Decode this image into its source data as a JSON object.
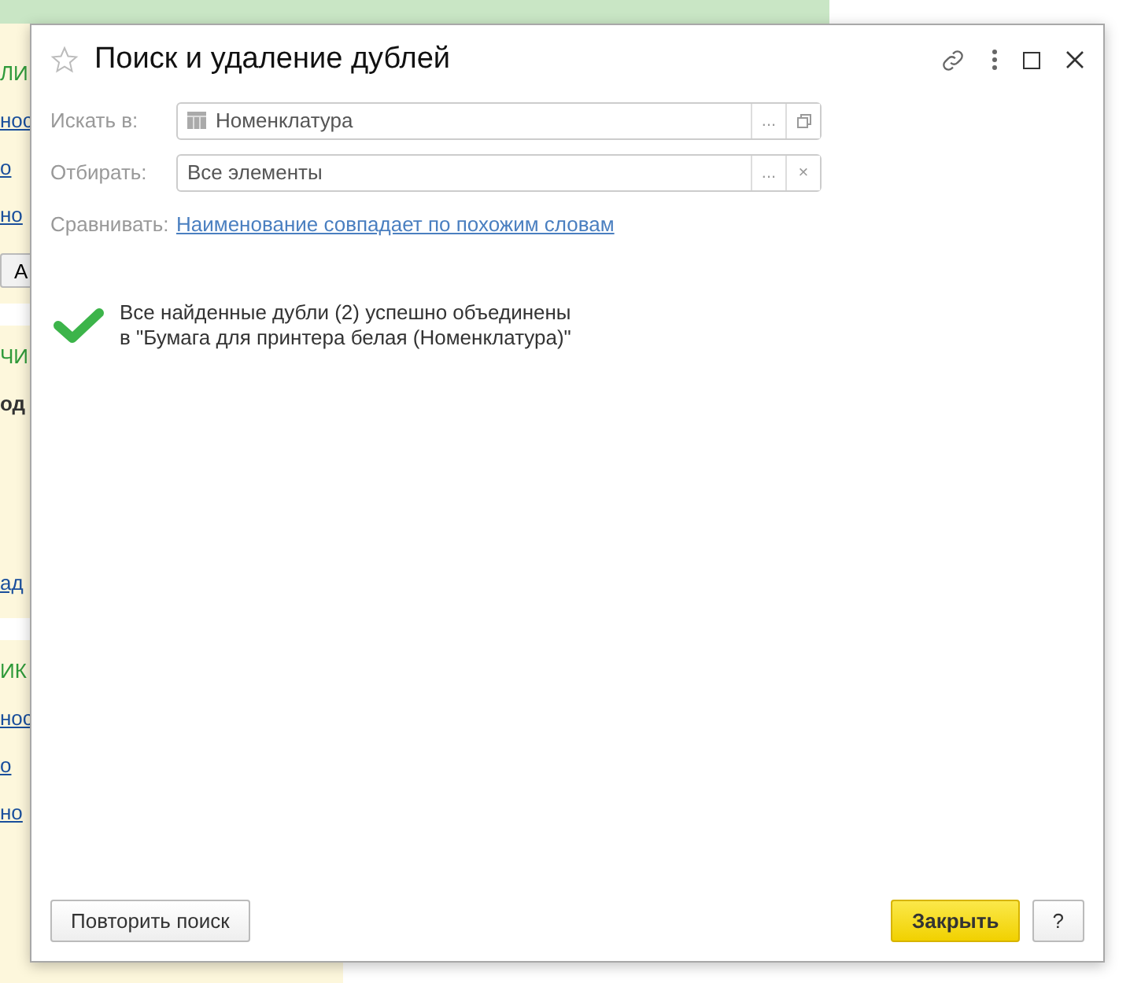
{
  "background": {
    "fragments": [
      {
        "kind": "heading",
        "text": "ЛИ"
      },
      {
        "kind": "link",
        "text": "нос"
      },
      {
        "kind": "link",
        "text": "о"
      },
      {
        "kind": "link",
        "text": "но"
      },
      {
        "kind": "button",
        "text": "А"
      },
      {
        "kind": "gap"
      },
      {
        "kind": "heading",
        "text": "ЧИ"
      },
      {
        "kind": "bold",
        "text": "од"
      },
      {
        "kind": "spacer"
      },
      {
        "kind": "link",
        "text": "ад"
      },
      {
        "kind": "gap"
      },
      {
        "kind": "heading",
        "text": "ИК"
      },
      {
        "kind": "link",
        "text": "нос"
      },
      {
        "kind": "link",
        "text": "о"
      },
      {
        "kind": "link",
        "text": "но"
      }
    ]
  },
  "window": {
    "title": "Поиск и удаление дублей",
    "favorite": false
  },
  "fields": [
    {
      "label": "Искать в:",
      "value": "Номенклатура",
      "kind": "table",
      "buttons": [
        {
          "kind": "text",
          "text": "..."
        },
        {
          "kind": "open"
        }
      ]
    },
    {
      "label": "Отбирать:",
      "value": "Все элементы",
      "kind": "plain",
      "buttons": [
        {
          "kind": "text",
          "text": "..."
        },
        {
          "kind": "text",
          "text": "×"
        }
      ]
    }
  ],
  "compare": {
    "label": "Сравнивать:",
    "link": "Наименование совпадает по похожим словам"
  },
  "result": {
    "kind": "success",
    "lines": [
      "Все найденные дубли (2) успешно объединены",
      "в \"Бумага для принтера белая (Номенклатура)\""
    ]
  },
  "footer": {
    "repeat": "Повторить поиск",
    "close": "Закрыть",
    "help": "?"
  }
}
